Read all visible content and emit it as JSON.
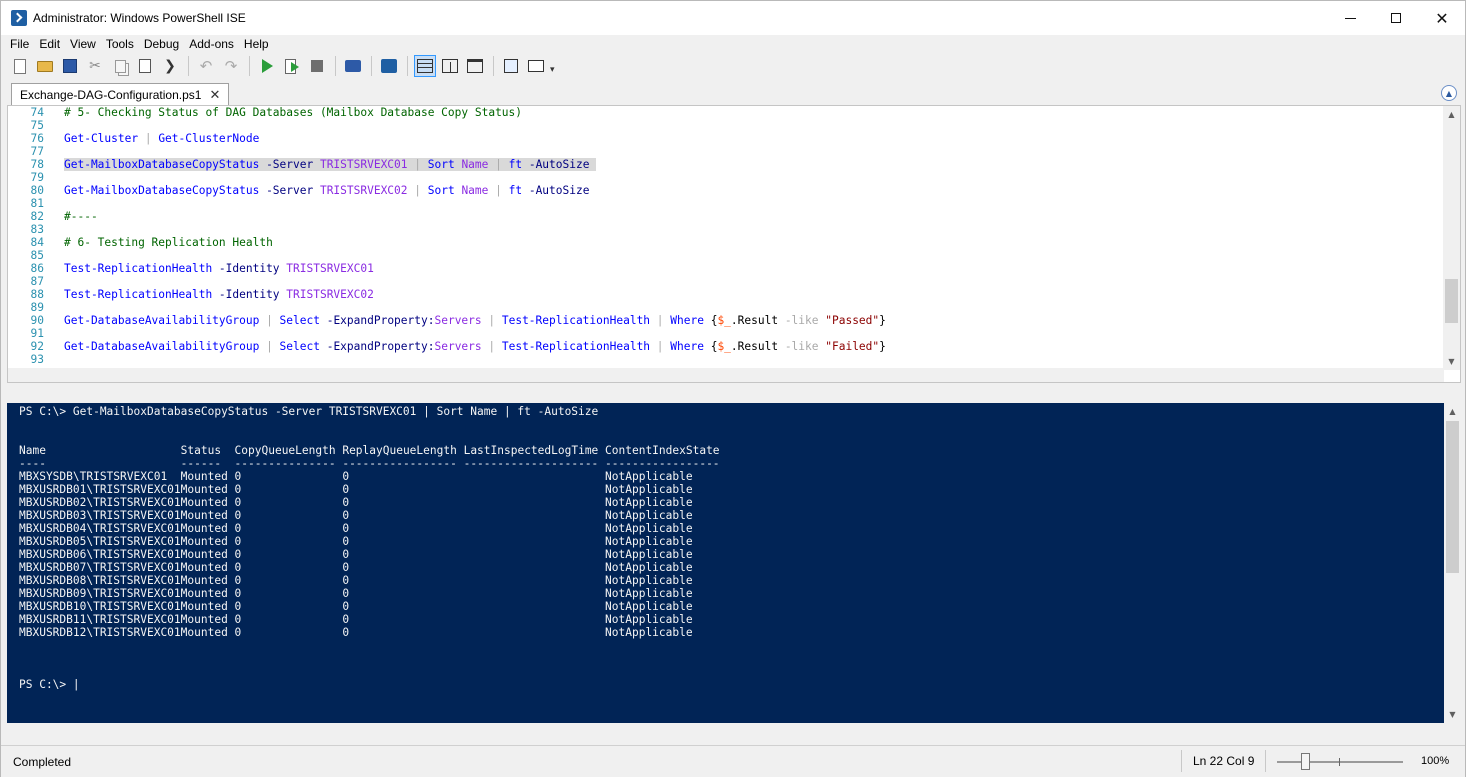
{
  "window": {
    "title": "Administrator: Windows PowerShell ISE",
    "minimize_glyph": "",
    "close_glyph": "✕"
  },
  "menu": [
    "File",
    "Edit",
    "View",
    "Tools",
    "Debug",
    "Add-ons",
    "Help"
  ],
  "toolbar": {
    "icons": [
      "new-script-icon",
      "open-folder-icon",
      "save-icon",
      "cut-icon",
      "copy-icon",
      "paste-icon",
      "powershell-clear-icon",
      "undo-icon",
      "redo-icon",
      "run-script-icon",
      "run-selection-icon",
      "stop-icon",
      "remote-powershell-icon",
      "start-powershell-icon",
      "script-pane-top-icon",
      "script-pane-right-icon",
      "script-pane-maximized-icon",
      "command-window-icon",
      "addon-tool-icon"
    ],
    "undo_glyph": "↶",
    "redo_glyph": "↷",
    "cut_glyph": "✂",
    "ps_glyph": "❯",
    "more_glyph": "▾"
  },
  "tabs": [
    {
      "label": "Exchange-DAG-Configuration.ps1",
      "close": "✕",
      "active": true
    }
  ],
  "editor": {
    "lines": [
      {
        "n": "74",
        "tokens": [
          {
            "t": "# 5- Checking Status of DAG Databases (Mailbox Database Copy Status)",
            "c": "comment"
          }
        ]
      },
      {
        "n": "75",
        "tokens": []
      },
      {
        "n": "76",
        "tokens": [
          {
            "t": "Get-Cluster",
            "c": "cmd"
          },
          {
            "t": " | ",
            "c": "op"
          },
          {
            "t": "Get-ClusterNode",
            "c": "cmd"
          }
        ]
      },
      {
        "n": "77",
        "tokens": []
      },
      {
        "n": "78",
        "highlight": true,
        "tokens": [
          {
            "t": "Get-MailboxDatabaseCopyStatus",
            "c": "cmd"
          },
          {
            "t": " -Server ",
            "c": "param"
          },
          {
            "t": "TRISTSRVEXC01",
            "c": "arg"
          },
          {
            "t": " | ",
            "c": "op"
          },
          {
            "t": "Sort",
            "c": "cmd"
          },
          {
            "t": " ",
            "c": "plain"
          },
          {
            "t": "Name",
            "c": "arg"
          },
          {
            "t": " | ",
            "c": "op"
          },
          {
            "t": "ft",
            "c": "cmd"
          },
          {
            "t": " -AutoSize ",
            "c": "param"
          }
        ]
      },
      {
        "n": "79",
        "tokens": []
      },
      {
        "n": "80",
        "tokens": [
          {
            "t": "Get-MailboxDatabaseCopyStatus",
            "c": "cmd"
          },
          {
            "t": " -Server ",
            "c": "param"
          },
          {
            "t": "TRISTSRVEXC02",
            "c": "arg"
          },
          {
            "t": " | ",
            "c": "op"
          },
          {
            "t": "Sort",
            "c": "cmd"
          },
          {
            "t": " ",
            "c": "plain"
          },
          {
            "t": "Name",
            "c": "arg"
          },
          {
            "t": " | ",
            "c": "op"
          },
          {
            "t": "ft",
            "c": "cmd"
          },
          {
            "t": " -AutoSize",
            "c": "param"
          }
        ]
      },
      {
        "n": "81",
        "tokens": []
      },
      {
        "n": "82",
        "tokens": [
          {
            "t": "#----",
            "c": "comment"
          }
        ]
      },
      {
        "n": "83",
        "tokens": []
      },
      {
        "n": "84",
        "tokens": [
          {
            "t": "# 6- Testing Replication Health",
            "c": "comment"
          }
        ]
      },
      {
        "n": "85",
        "tokens": []
      },
      {
        "n": "86",
        "tokens": [
          {
            "t": "Test-ReplicationHealth",
            "c": "cmd"
          },
          {
            "t": " -Identity ",
            "c": "param"
          },
          {
            "t": "TRISTSRVEXC01",
            "c": "arg"
          }
        ]
      },
      {
        "n": "87",
        "tokens": []
      },
      {
        "n": "88",
        "tokens": [
          {
            "t": "Test-ReplicationHealth",
            "c": "cmd"
          },
          {
            "t": " -Identity ",
            "c": "param"
          },
          {
            "t": "TRISTSRVEXC02",
            "c": "arg"
          }
        ]
      },
      {
        "n": "89",
        "tokens": []
      },
      {
        "n": "90",
        "tokens": [
          {
            "t": "Get-DatabaseAvailabilityGroup",
            "c": "cmd"
          },
          {
            "t": " | ",
            "c": "op"
          },
          {
            "t": "Select",
            "c": "cmd"
          },
          {
            "t": " -ExpandProperty:",
            "c": "param"
          },
          {
            "t": "Servers",
            "c": "arg"
          },
          {
            "t": " | ",
            "c": "op"
          },
          {
            "t": "Test-ReplicationHealth",
            "c": "cmd"
          },
          {
            "t": " | ",
            "c": "op"
          },
          {
            "t": "Where",
            "c": "cmd"
          },
          {
            "t": " {",
            "c": "plain"
          },
          {
            "t": "$_",
            "c": "var"
          },
          {
            "t": ".Result ",
            "c": "plain"
          },
          {
            "t": "-like",
            "c": "op"
          },
          {
            "t": " ",
            "c": "plain"
          },
          {
            "t": "\"Passed\"",
            "c": "str"
          },
          {
            "t": "}",
            "c": "plain"
          }
        ]
      },
      {
        "n": "91",
        "tokens": []
      },
      {
        "n": "92",
        "tokens": [
          {
            "t": "Get-DatabaseAvailabilityGroup",
            "c": "cmd"
          },
          {
            "t": " | ",
            "c": "op"
          },
          {
            "t": "Select",
            "c": "cmd"
          },
          {
            "t": " -ExpandProperty:",
            "c": "param"
          },
          {
            "t": "Servers",
            "c": "arg"
          },
          {
            "t": " | ",
            "c": "op"
          },
          {
            "t": "Test-ReplicationHealth",
            "c": "cmd"
          },
          {
            "t": " | ",
            "c": "op"
          },
          {
            "t": "Where",
            "c": "cmd"
          },
          {
            "t": " {",
            "c": "plain"
          },
          {
            "t": "$_",
            "c": "var"
          },
          {
            "t": ".Result ",
            "c": "plain"
          },
          {
            "t": "-like",
            "c": "op"
          },
          {
            "t": " ",
            "c": "plain"
          },
          {
            "t": "\"Failed\"",
            "c": "str"
          },
          {
            "t": "}",
            "c": "plain"
          }
        ]
      },
      {
        "n": "93",
        "tokens": []
      }
    ],
    "scroll_up": "▲",
    "scroll_down": "▼"
  },
  "console": {
    "command": "PS C:\\> Get-MailboxDatabaseCopyStatus -Server TRISTSRVEXC01 | Sort Name | ft -AutoSize",
    "columns": [
      "Name",
      "Status",
      "CopyQueueLength",
      "ReplayQueueLength",
      "LastInspectedLogTime",
      "ContentIndexState"
    ],
    "underlines": [
      "----",
      "------",
      "---------------",
      "-----------------",
      "--------------------",
      "-----------------"
    ],
    "rows": [
      [
        "MBXSYSDB\\TRISTSRVEXC01",
        "Mounted",
        "0",
        "0",
        "",
        "NotApplicable"
      ],
      [
        "MBXUSRDB01\\TRISTSRVEXC01",
        "Mounted",
        "0",
        "0",
        "",
        "NotApplicable"
      ],
      [
        "MBXUSRDB02\\TRISTSRVEXC01",
        "Mounted",
        "0",
        "0",
        "",
        "NotApplicable"
      ],
      [
        "MBXUSRDB03\\TRISTSRVEXC01",
        "Mounted",
        "0",
        "0",
        "",
        "NotApplicable"
      ],
      [
        "MBXUSRDB04\\TRISTSRVEXC01",
        "Mounted",
        "0",
        "0",
        "",
        "NotApplicable"
      ],
      [
        "MBXUSRDB05\\TRISTSRVEXC01",
        "Mounted",
        "0",
        "0",
        "",
        "NotApplicable"
      ],
      [
        "MBXUSRDB06\\TRISTSRVEXC01",
        "Mounted",
        "0",
        "0",
        "",
        "NotApplicable"
      ],
      [
        "MBXUSRDB07\\TRISTSRVEXC01",
        "Mounted",
        "0",
        "0",
        "",
        "NotApplicable"
      ],
      [
        "MBXUSRDB08\\TRISTSRVEXC01",
        "Mounted",
        "0",
        "0",
        "",
        "NotApplicable"
      ],
      [
        "MBXUSRDB09\\TRISTSRVEXC01",
        "Mounted",
        "0",
        "0",
        "",
        "NotApplicable"
      ],
      [
        "MBXUSRDB10\\TRISTSRVEXC01",
        "Mounted",
        "0",
        "0",
        "",
        "NotApplicable"
      ],
      [
        "MBXUSRDB11\\TRISTSRVEXC01",
        "Mounted",
        "0",
        "0",
        "",
        "NotApplicable"
      ],
      [
        "MBXUSRDB12\\TRISTSRVEXC01",
        "Mounted",
        "0",
        "0",
        "",
        "NotApplicable"
      ]
    ],
    "prompt": "PS C:\\> |",
    "scroll_up": "▲",
    "scroll_down": "▼",
    "background": "#012456"
  },
  "status": {
    "left": "Completed",
    "position": "Ln 22  Col 9",
    "zoom": "100%",
    "zoom_value": 100
  }
}
